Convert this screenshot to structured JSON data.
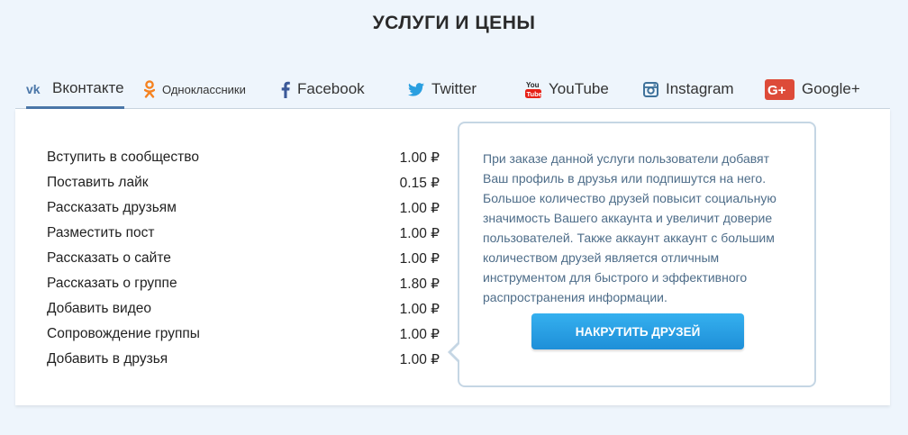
{
  "page": {
    "title": "УСЛУГИ И ЦЕНЫ"
  },
  "tabs": [
    {
      "label": "Вконтакте",
      "icon": "vk-icon",
      "color": "#4a76a8",
      "active": true
    },
    {
      "label": "Одноклассники",
      "icon": "odnoklassniki-icon",
      "color": "#f58220"
    },
    {
      "label": "Facebook",
      "icon": "facebook-icon",
      "color": "#3b5998"
    },
    {
      "label": "Twitter",
      "icon": "twitter-icon",
      "color": "#2a9fe0"
    },
    {
      "label": "YouTube",
      "icon": "youtube-icon",
      "color": "#e62117"
    },
    {
      "label": "Instagram",
      "icon": "instagram-icon",
      "color": "#3f729b"
    },
    {
      "label": "Google+",
      "icon": "google-plus-icon",
      "color": "#dd4b39"
    }
  ],
  "services": [
    {
      "name": "Вступить в сообщество",
      "price": "1.00 ₽"
    },
    {
      "name": "Поставить лайк",
      "price": "0.15 ₽"
    },
    {
      "name": "Рассказать друзьям",
      "price": "1.00 ₽"
    },
    {
      "name": "Разместить пост",
      "price": "1.00 ₽"
    },
    {
      "name": "Рассказать о сайте",
      "price": "1.00 ₽"
    },
    {
      "name": "Рассказать о группе",
      "price": "1.80 ₽"
    },
    {
      "name": "Добавить видео",
      "price": "1.00 ₽"
    },
    {
      "name": "Сопровождение группы",
      "price": "1.00 ₽"
    },
    {
      "name": "Добавить в друзья",
      "price": "1.00 ₽"
    }
  ],
  "info": {
    "text": "При заказе данной услуги пользователи добавят Ваш профиль в друзья или подпишутся на него. Большое количество друзей повысит социальную значимость Вашего аккаунта и увеличит доверие пользователей. Также аккаунт аккаунт с большим количеством друзей является отличным инструментом для быстрого и эффективного распространения информации.",
    "button_label": "НАКРУТИТЬ ДРУЗЕЙ"
  }
}
